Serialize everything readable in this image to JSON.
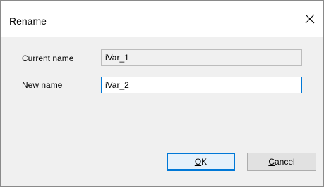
{
  "dialog": {
    "title": "Rename",
    "close_icon": "close-icon"
  },
  "form": {
    "current_name_label": "Current name",
    "current_name_value": "iVar_1",
    "new_name_label": "New name",
    "new_name_value": "iVar_2"
  },
  "buttons": {
    "ok_mnemonic": "O",
    "ok_rest": "K",
    "cancel_mnemonic": "C",
    "cancel_rest": "ancel"
  },
  "colors": {
    "accent": "#0078d7",
    "dialog_background": "#f0f0f0",
    "titlebar_background": "#ffffff"
  }
}
